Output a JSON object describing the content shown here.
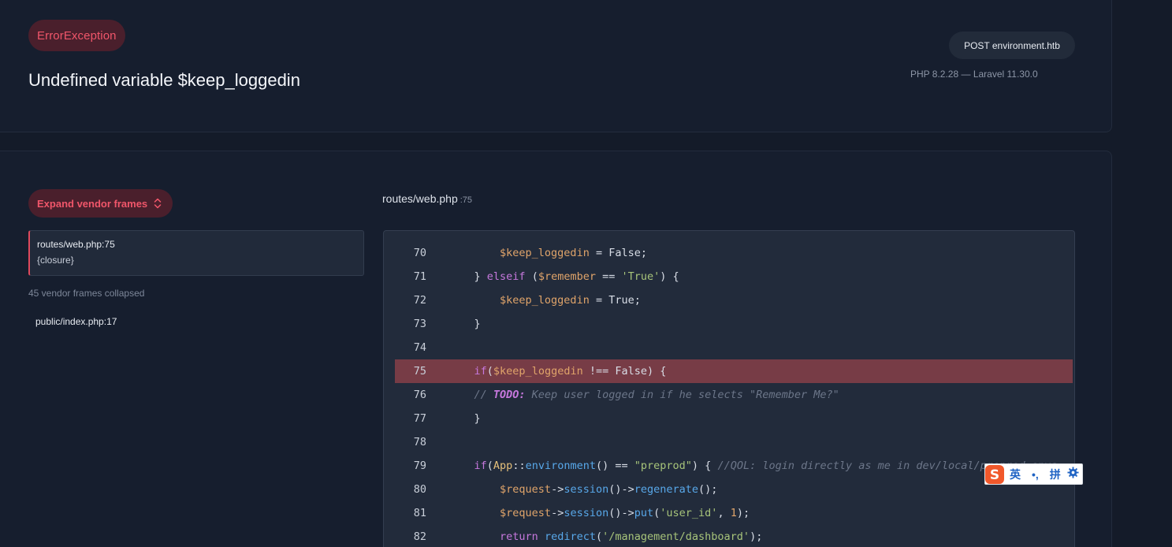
{
  "header": {
    "exception_type": "ErrorException",
    "message": "Undefined variable $keep_loggedin",
    "request": "POST environment.htb",
    "versions": "PHP 8.2.28 — Laravel 11.30.0"
  },
  "stack": {
    "expand_label": "Expand vendor frames",
    "active_frame": {
      "file": "routes/web.php:75",
      "function": "{closure}"
    },
    "vendor_collapsed": "45 vendor frames collapsed",
    "other_frames": [
      {
        "file": "public/index.php:17"
      }
    ]
  },
  "editor": {
    "file": "routes/web.php",
    "line_ref": ":75",
    "highlight_line": 75,
    "lines": [
      {
        "num": "70"
      },
      {
        "num": "71"
      },
      {
        "num": "72"
      },
      {
        "num": "73"
      },
      {
        "num": "74"
      },
      {
        "num": "75"
      },
      {
        "num": "76"
      },
      {
        "num": "77"
      },
      {
        "num": "78"
      },
      {
        "num": "79"
      },
      {
        "num": "80"
      },
      {
        "num": "81"
      },
      {
        "num": "82"
      }
    ],
    "code": {
      "l70": {
        "var": "$keep_loggedin",
        "rest": " = False;"
      },
      "l71": {
        "close": "} ",
        "kw": "elseif",
        "open": " (",
        "var": "$remember",
        "op": " == ",
        "str": "'True'",
        "rest": ") {"
      },
      "l72": {
        "var": "$keep_loggedin",
        "rest": " = True;"
      },
      "l73": {
        "text": "}"
      },
      "l75": {
        "kw": "if",
        "open": "(",
        "var": "$keep_loggedin",
        "rest": " !== False) {"
      },
      "l76": {
        "cmt_start": "// ",
        "todo": "TODO:",
        "cmt_rest": " Keep user logged in if he selects \"Remember Me?\""
      },
      "l77": {
        "text": "}"
      },
      "l79": {
        "kw": "if",
        "open": "(",
        "cls": "App",
        "sep": "::",
        "fn": "environment",
        "mid": "() == ",
        "str": "\"preprod\"",
        "rest": ") { ",
        "cmt": "//QOL: login directly as me in dev/local/preprod envs"
      },
      "l80": {
        "var": "$request",
        "arrow1": "->",
        "fn1": "session",
        "mid": "()->",
        "fn2": "regenerate",
        "rest": "();"
      },
      "l81": {
        "var": "$request",
        "arrow1": "->",
        "fn1": "session",
        "mid": "()->",
        "fn2": "put",
        "open": "(",
        "str": "'user_id'",
        "sep": ", ",
        "num": "1",
        "rest": ");"
      },
      "l82": {
        "kw": "return",
        "sp": " ",
        "fn": "redirect",
        "open": "(",
        "str": "'/management/dashboard'",
        "rest": ");"
      }
    }
  },
  "ime": {
    "logo_letter": "S",
    "mode": "英",
    "punct": "•,",
    "pinyin": "拼",
    "gear_icon": "gear-icon"
  },
  "colors": {
    "accent": "#f0566a",
    "badge_bg": "#4a1f2c",
    "highlight_line_bg": "#773c46",
    "background": "#141b29"
  }
}
